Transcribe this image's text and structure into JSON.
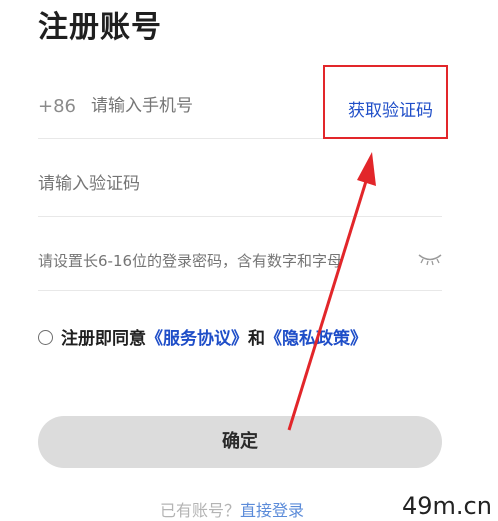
{
  "page": {
    "title": "注册账号"
  },
  "phone": {
    "country_code": "+86",
    "placeholder": "请输入手机号",
    "get_code_label": "获取验证码"
  },
  "code": {
    "placeholder": "请输入验证码"
  },
  "password": {
    "placeholder": "请设置长6-16位的登录密码，含有数字和字母",
    "toggle_icon": "eye-closed-icon"
  },
  "agreement": {
    "prefix": "注册即同意",
    "service_link": "《服务协议》",
    "and": "和",
    "privacy_link": "《隐私政策》"
  },
  "confirm_label": "确定",
  "login": {
    "prompt": "已有账号？",
    "link": "直接登录"
  },
  "watermark": "49m.cn",
  "colors": {
    "link_blue": "#1f4ec8",
    "highlight_red": "#e2262a",
    "button_gray": "#dcdcdc"
  }
}
